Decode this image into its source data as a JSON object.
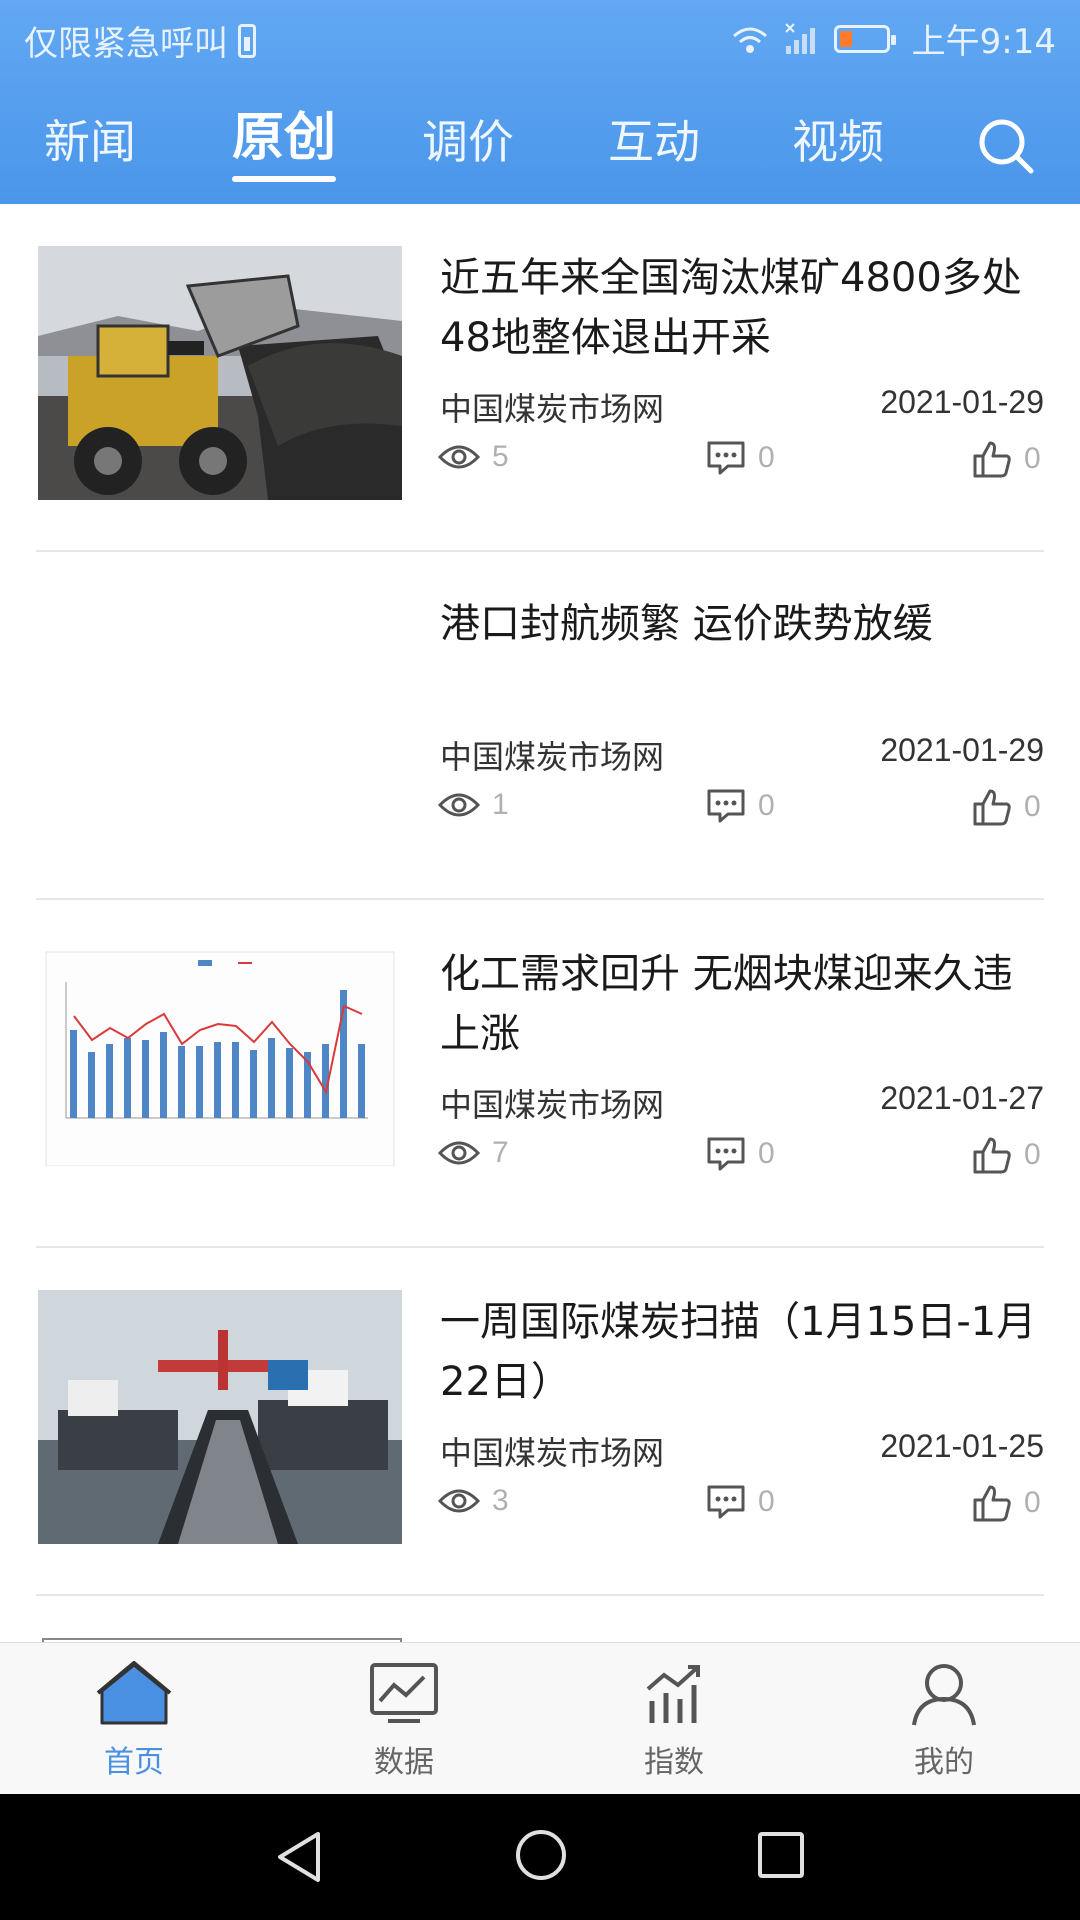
{
  "status_bar": {
    "carrier": "仅限紧急呼叫",
    "time": "上午9:14"
  },
  "nav": {
    "tabs": [
      "新闻",
      "原创",
      "调价",
      "互动",
      "视频"
    ],
    "active_index": 1
  },
  "articles": [
    {
      "title": "近五年来全国淘汰煤矿4800多处48地整体退出开采",
      "source": "中国煤炭市场网",
      "date": "2021-01-29",
      "views": "5",
      "comments": "0",
      "likes": "0",
      "thumb": "loader"
    },
    {
      "title": "港口封航频繁 运价跌势放缓",
      "source": "中国煤炭市场网",
      "date": "2021-01-29",
      "views": "1",
      "comments": "0",
      "likes": "0",
      "thumb": "none"
    },
    {
      "title": "化工需求回升 无烟块煤迎来久违上涨",
      "source": "中国煤炭市场网",
      "date": "2021-01-27",
      "views": "7",
      "comments": "0",
      "likes": "0",
      "thumb": "chart"
    },
    {
      "title": "一周国际煤炭扫描（1月15日-1月22日）",
      "source": "中国煤炭市场网",
      "date": "2021-01-25",
      "views": "3",
      "comments": "0",
      "likes": "0",
      "thumb": "ship"
    }
  ],
  "bottom_tabs": [
    "首页",
    "数据",
    "指数",
    "我的"
  ],
  "colors": {
    "header": "#4b96ea",
    "active_tab": "#4a90e2"
  }
}
